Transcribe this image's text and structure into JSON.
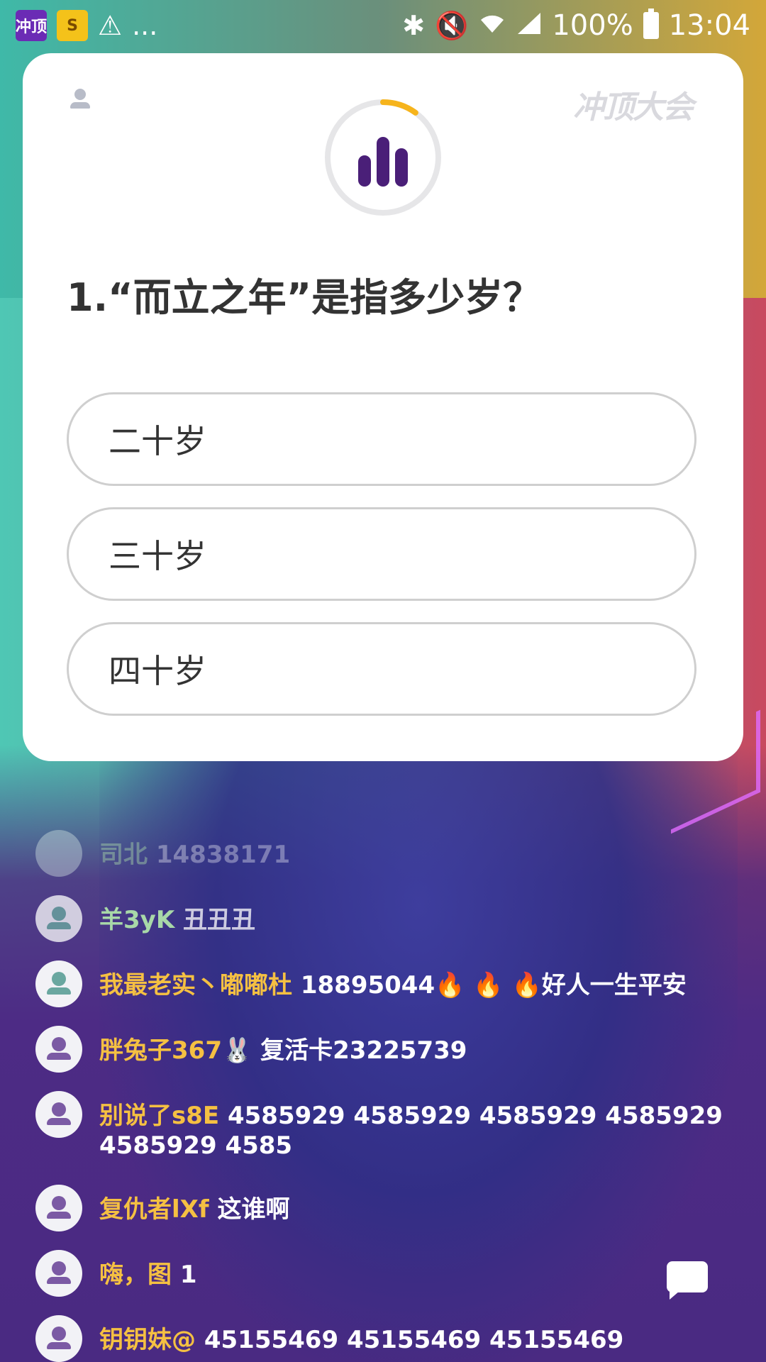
{
  "status_bar": {
    "app1_icon_label": "冲顶",
    "app2_icon_label": "S",
    "warning_icon": "warning-icon",
    "more": "...",
    "battery_percent": "100%",
    "time": "13:04"
  },
  "quiz": {
    "logo": "冲顶大会",
    "timer_progress": 0.1,
    "question": "1.“而立之年”是指多少岁？",
    "options": [
      "二十岁",
      "三十岁",
      "四十岁"
    ],
    "colors": {
      "timer_arc": "#f6b41c",
      "timer_bars": "#4a1f78"
    }
  },
  "comments": [
    {
      "name": "司北",
      "message": "14838171"
    },
    {
      "name": "羊3yK",
      "message": "丑丑丑"
    },
    {
      "name": "我最老实丶嘟嘟杜",
      "message": "18895044🔥 🔥 🔥好人一生平安"
    },
    {
      "name": "胖兔子367",
      "message": "🐰 复活卡23225739"
    },
    {
      "name": "别说了s8E",
      "message": "4585929  4585929   4585929  4585929  4585929  4585"
    },
    {
      "name": "复仇者lXf",
      "message": "这谁啊"
    },
    {
      "name": "嗨，图",
      "message": "1"
    },
    {
      "name": "钥钥妹@",
      "message": "45155469  45155469   45155469"
    }
  ]
}
